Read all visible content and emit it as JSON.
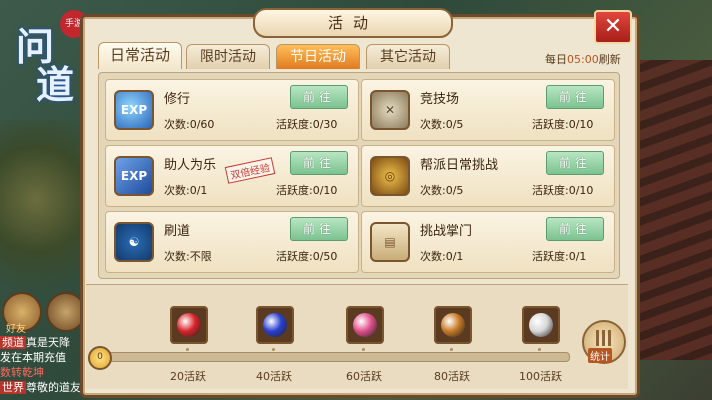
{
  "logo": {
    "text_top": "问",
    "text_bottom": "道",
    "seal": "手游"
  },
  "chat": {
    "lines": [
      {
        "tag": "频道",
        "text": "真是天降"
      },
      {
        "tag": "",
        "text": "发在本期充值"
      },
      {
        "tag": "",
        "text": "数转乾坤"
      },
      {
        "tag": "世界",
        "text": "尊敬的道友"
      }
    ]
  },
  "side": {
    "friend_label": "好友"
  },
  "panel": {
    "title": "活动",
    "close_glyph": "✕",
    "tabs": [
      {
        "label": "日常活动",
        "state": "active"
      },
      {
        "label": "限时活动",
        "state": "normal"
      },
      {
        "label": "节日活动",
        "state": "hot"
      },
      {
        "label": "其它活动",
        "state": "normal"
      }
    ],
    "refresh": {
      "prefix": "每日",
      "time": "05:00",
      "suffix": "刷新"
    }
  },
  "activities": [
    {
      "name": "修行",
      "times": "次数:0/60",
      "activity": "活跃度:0/30",
      "button": "前往",
      "icon": "exp-orb-icon",
      "stamp": ""
    },
    {
      "name": "竞技场",
      "times": "次数:0/5",
      "activity": "活跃度:0/10",
      "button": "前往",
      "icon": "crossed-swords-icon",
      "stamp": ""
    },
    {
      "name": "助人为乐",
      "times": "次数:0/1",
      "activity": "活跃度:0/10",
      "button": "前往",
      "icon": "exp-book-icon",
      "stamp": "双倍经验"
    },
    {
      "name": "帮派日常挑战",
      "times": "次数:0/5",
      "activity": "活跃度:0/10",
      "button": "前往",
      "icon": "gold-coin-icon",
      "stamp": ""
    },
    {
      "name": "刷道",
      "times": "次数:不限",
      "activity": "活跃度:0/50",
      "button": "前往",
      "icon": "taiji-icon",
      "stamp": ""
    },
    {
      "name": "挑战掌门",
      "times": "次数:0/1",
      "activity": "活跃度:0/1",
      "button": "前往",
      "icon": "id-scroll-icon",
      "stamp": ""
    }
  ],
  "progress": {
    "current": 0,
    "max": 100,
    "current_label": "0",
    "milestones": [
      {
        "label": "20活跃",
        "reward": "red-orb-icon",
        "color": "#d8232a"
      },
      {
        "label": "40活跃",
        "reward": "blue-orb-icon",
        "color": "#2a3fd0"
      },
      {
        "label": "60活跃",
        "reward": "pink-gems-icon",
        "color": "#e0508a"
      },
      {
        "label": "80活跃",
        "reward": "treasure-chest-icon",
        "color": "#c87a24"
      },
      {
        "label": "100活跃",
        "reward": "silver-ingot-icon",
        "color": "#d8d8d8"
      }
    ],
    "stats_label": "统计"
  }
}
